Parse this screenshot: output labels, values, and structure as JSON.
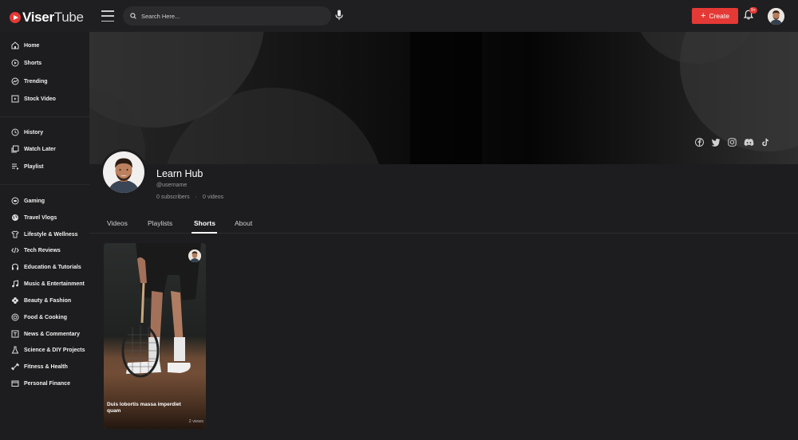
{
  "header": {
    "logo_main": "Viser",
    "logo_accent": "Tube",
    "search_placeholder": "Search Here...",
    "create_label": "Create",
    "notification_badge": "9+"
  },
  "sidebar": {
    "group1": [
      "Home",
      "Shorts",
      "Trending",
      "Stock Video"
    ],
    "group2": [
      "History",
      "Watch Later",
      "Playlist"
    ],
    "group3": [
      "Gaming",
      "Travel Vlogs",
      "Lifestyle & Wellness",
      "Tech Reviews",
      "Education & Tutorials",
      "Music & Entertainment",
      "Beauty & Fashion",
      "Food & Cooking",
      "News & Commentary",
      "Science & DIY Projects",
      "Fitness & Health",
      "Personal Finance"
    ]
  },
  "channel": {
    "name": "Learn Hub",
    "username": "@username",
    "subscribers": "0 subscribers",
    "videos": "0 videos",
    "socials": [
      "facebook-icon",
      "twitter-icon",
      "instagram-icon",
      "discord-icon",
      "tiktok-icon"
    ]
  },
  "tabs": [
    "Videos",
    "Playlists",
    "Shorts",
    "About"
  ],
  "active_tab": "Shorts",
  "shorts": [
    {
      "title": "Duis lobortis massa imperdiet quam",
      "views": "2 views"
    }
  ],
  "colors": {
    "accent": "#e53935",
    "background": "#1d1d1f"
  }
}
